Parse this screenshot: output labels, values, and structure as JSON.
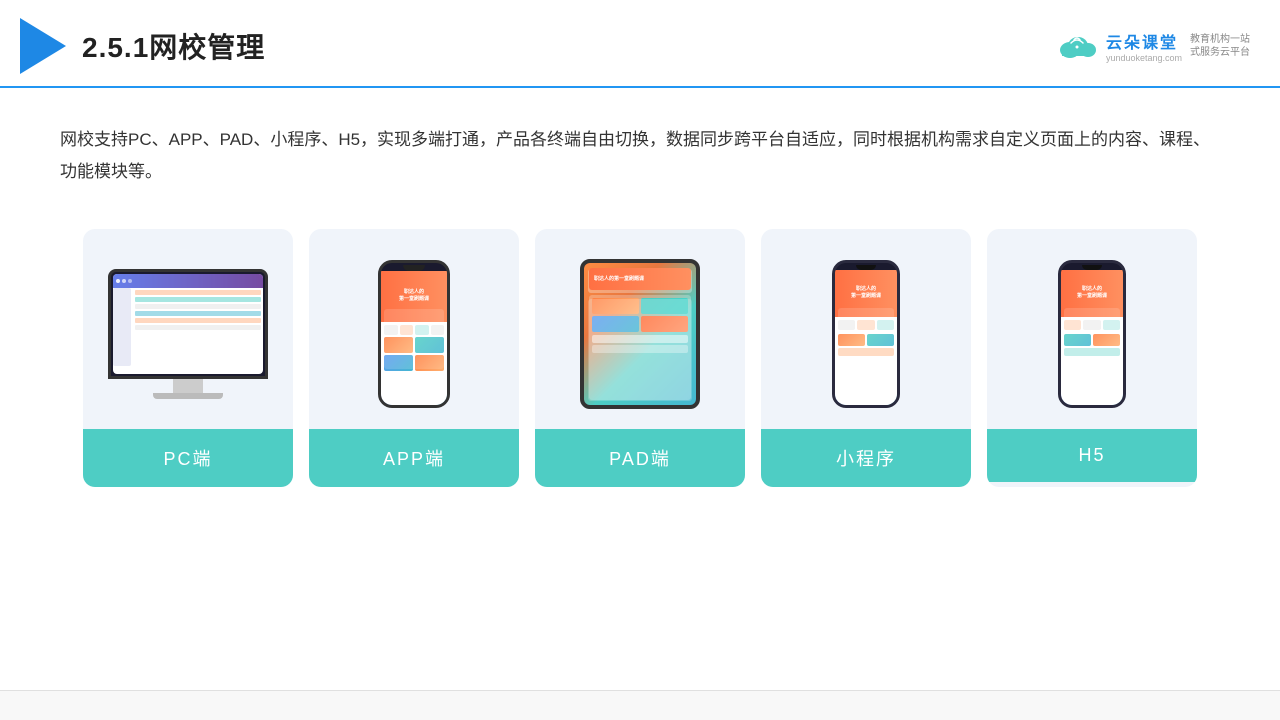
{
  "header": {
    "section_number": "2.5.1",
    "title": "网校管理",
    "brand": {
      "name": "云朵课堂",
      "pinyin": "yunduoketang.com",
      "tagline": "教育机构一站\n式服务云平台"
    }
  },
  "description": "网校支持PC、APP、PAD、小程序、H5，实现多端打通，产品各终端自由切换，数据同步跨平台自适应，同时根据机构需求自定义页面上的内容、课程、功能模块等。",
  "cards": [
    {
      "id": "pc",
      "label": "PC端",
      "type": "pc"
    },
    {
      "id": "app",
      "label": "APP端",
      "type": "phone"
    },
    {
      "id": "pad",
      "label": "PAD端",
      "type": "tablet"
    },
    {
      "id": "miniapp",
      "label": "小程序",
      "type": "narrow-phone"
    },
    {
      "id": "h5",
      "label": "H5",
      "type": "narrow-phone2"
    }
  ],
  "colors": {
    "accent_teal": "#4ecdc4",
    "accent_blue": "#1e88e5",
    "text_dark": "#333333",
    "bg_card": "#f0f4fa"
  }
}
